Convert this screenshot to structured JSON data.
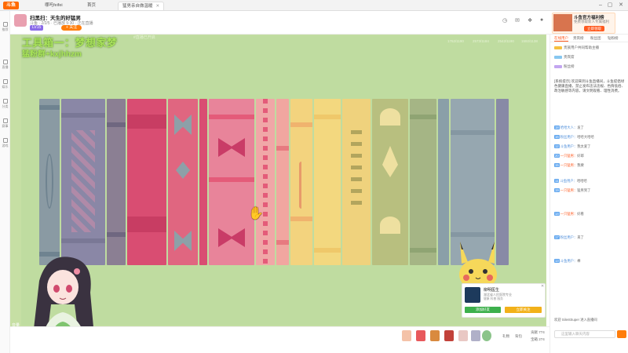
{
  "browser": {
    "logo": "斗鱼",
    "tabs": [
      {
        "label": "哪吒feifei",
        "active": false
      },
      {
        "label": "首页",
        "active": false
      },
      {
        "label": "猛男亲自做温暖",
        "active": true
      },
      {
        "label": "✕",
        "active": false
      }
    ]
  },
  "header": {
    "title": "扫黑扫：天生的好猛男",
    "meta": "斗鱼 · 2/2/5 · 已播放 5:30 · 正在直播",
    "level": "LV15",
    "follow_label": "+ 关注",
    "icons": [
      "history-icon",
      "message-icon",
      "gift-icon",
      "avatar"
    ]
  },
  "ad": {
    "title": "斗鱼官方福利榜",
    "subtitle": "免费领取新人专属福利",
    "button": "立即领取"
  },
  "left_nav": {
    "items": [
      "推荐",
      "直播",
      "娱乐",
      "分类",
      "赛事",
      "游戏"
    ]
  },
  "player": {
    "watermark_line1": "工具箱一：梦想家梦",
    "watermark_line2": "猛粉群+kxjhhzm",
    "room_tag": "#直播已开启",
    "dim_tags": [
      "1762/1190",
      "2573/1184",
      "2542/1190",
      "1592/1138"
    ],
    "volume": "音量"
  },
  "promo_card": {
    "name": "柳明医生",
    "subtitle": "湖北省人民医院专业",
    "tags": [
      "健康",
      "科普",
      "服务"
    ],
    "button_primary": "添加好友",
    "button_secondary": "立即关注"
  },
  "bottom_bar": {
    "labels": [
      "礼物",
      "背包",
      "贡献"
    ],
    "stats": [
      "贡献 774",
      "宝箱 274"
    ]
  },
  "chat": {
    "tabs": [
      "在线用户",
      "贵宾榜",
      "粉丝团",
      "钻粉榜"
    ],
    "rank_rows": [
      "贵族用户共同帮助主播",
      "贵宾席",
      "粉丝榜"
    ],
    "notice": "[系统提示] 欢迎来到斗鱼直播间，斗鱼提倡绿色健康直播，禁止发布违法违规、色情低俗、政治敏感等内容，请文明观看、理性消费。",
    "messages": [
      {
        "level": "18",
        "name": "哈哈大人：",
        "text": "发了"
      },
      {
        "level": "16",
        "name": "粉丝用户：",
        "text": "哈哈大哈哈"
      },
      {
        "level": "12",
        "name": "斗鱼用户：",
        "text": "我太爱了"
      },
      {
        "level": "20",
        "name": "一只猛男：",
        "text": "好耶"
      },
      {
        "level": "15",
        "name": "一只猛男：",
        "text": "我要"
      },
      {
        "level": "11",
        "name": "斗鱼用户：",
        "text": "哈哈哈"
      },
      {
        "level": "19",
        "name": "一只猛男：",
        "text": "猛男到了"
      },
      {
        "level": "14",
        "name": "一只猛男：",
        "text": "好看"
      },
      {
        "level": "17",
        "name": "粉丝用户：",
        "text": "来了"
      },
      {
        "level": "13",
        "name": "斗鱼用户：",
        "text": "棒"
      }
    ],
    "bottom_line": "欢迎 SilentSuper 进入直播间",
    "input_placeholder": "这里输入聊天内容"
  }
}
